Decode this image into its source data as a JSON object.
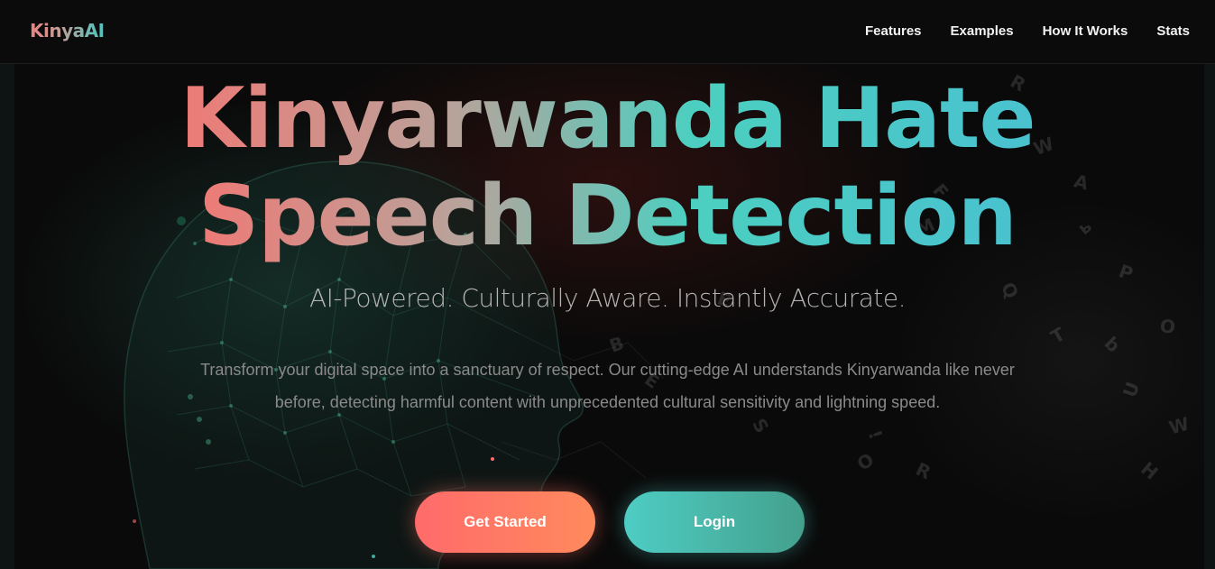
{
  "brand": "KinyaAI",
  "nav": {
    "features": "Features",
    "examples": "Examples",
    "how_it_works": "How It Works",
    "stats": "Stats"
  },
  "hero": {
    "headline_line1": "Kinyarwanda Hate",
    "headline_line2": "Speech Detection",
    "tagline": "AI-Powered. Culturally Aware. Instantly Accurate.",
    "description": "Transform your digital space into a sanctuary of respect. Our cutting-edge AI understands Kinyarwanda like never before, detecting harmful content with unprecedented cultural sensitivity and lightning speed.",
    "get_started": "Get Started",
    "login": "Login"
  },
  "colors": {
    "accent_coral": "#ff6b6b",
    "accent_teal": "#4ecdc4",
    "background": "#070707"
  }
}
